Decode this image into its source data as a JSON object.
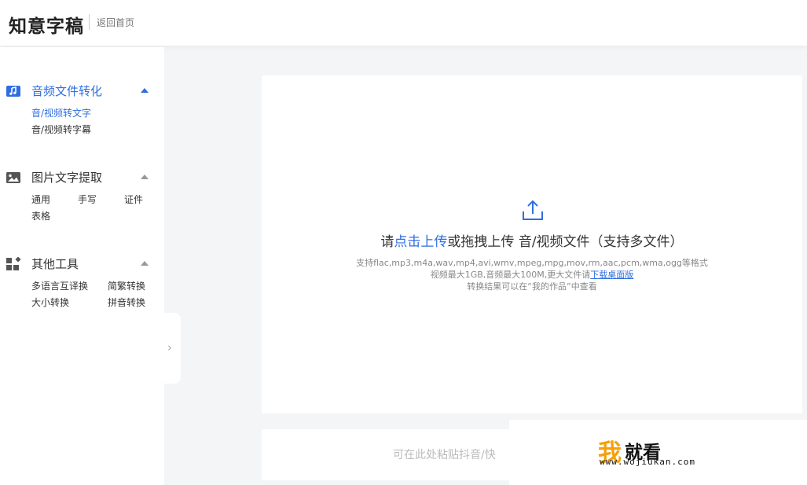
{
  "header": {
    "logo": "知意字稿",
    "back_link": "返回首页"
  },
  "sidebar": {
    "sections": [
      {
        "title": "音频文件转化",
        "icon": "video-icon",
        "items": [
          "音/视频转文字",
          "音/视频转字幕"
        ]
      },
      {
        "title": "图片文字提取",
        "icon": "image-icon",
        "items": [
          "通用",
          "手写",
          "证件",
          "表格"
        ]
      },
      {
        "title": "其他工具",
        "icon": "grid-icon",
        "items": [
          "多语言互译换",
          "简繁转换",
          "大小转换",
          "拼音转换"
        ]
      }
    ]
  },
  "collapse_tab": {
    "glyph": "›"
  },
  "upload": {
    "main_prefix": "请",
    "main_link": "点击上传",
    "main_suffix": "或拖拽上传 音/视频文件（支持多文件）",
    "formats_note": "支持flac,mp3,m4a,wav,mp4,avi,wmv,mpeg,mpg,mov,rm,aac,pcm,wma,ogg等格式",
    "size_note": "视频最大1GB,音频最大100M,更大文件请",
    "size_link": "下载桌面版",
    "result_note": "转换结果可以在“我的作品”中查看"
  },
  "paste": {
    "placeholder": "可在此处粘贴抖音/快"
  },
  "watermark": {
    "char_orange": "我",
    "chars_black": "就看",
    "url": "www.wojiukan.com"
  },
  "colors": {
    "accent": "#2f6ee0",
    "watermark_orange": "#f5a10a"
  }
}
